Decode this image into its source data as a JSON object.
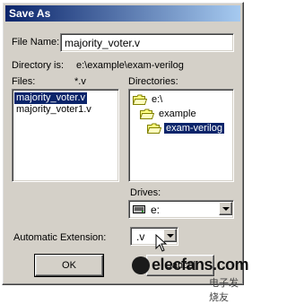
{
  "window": {
    "title": "Save As"
  },
  "file_name": {
    "label": "File Name:",
    "value": "majority_voter.v"
  },
  "directory": {
    "label": "Directory is:",
    "path": "e:\\example\\exam-verilog"
  },
  "files": {
    "label": "Files:",
    "filter": "*.v",
    "items": [
      "majority_voter.v",
      "majority_voter1.v"
    ],
    "selected_index": 0
  },
  "directories": {
    "label": "Directories:",
    "items": [
      {
        "label": "e:\\",
        "icon": "open-folder-icon"
      },
      {
        "label": "example",
        "icon": "open-folder-icon"
      },
      {
        "label": "exam-verilog",
        "icon": "open-folder-icon"
      }
    ],
    "selected_index": 2
  },
  "drives": {
    "label": "Drives:",
    "value": "e:",
    "icon": "drive-icon"
  },
  "automatic_extension": {
    "label": "Automatic Extension:",
    "value": ".v"
  },
  "buttons": {
    "ok": "OK",
    "cancel": "Cancel"
  },
  "watermark": {
    "text": "elecfans.com",
    "subtext": "电子发烧友"
  },
  "colors": {
    "title_bar": "#0a246a",
    "selection": "#0a246a",
    "face": "#d4d0c8"
  }
}
